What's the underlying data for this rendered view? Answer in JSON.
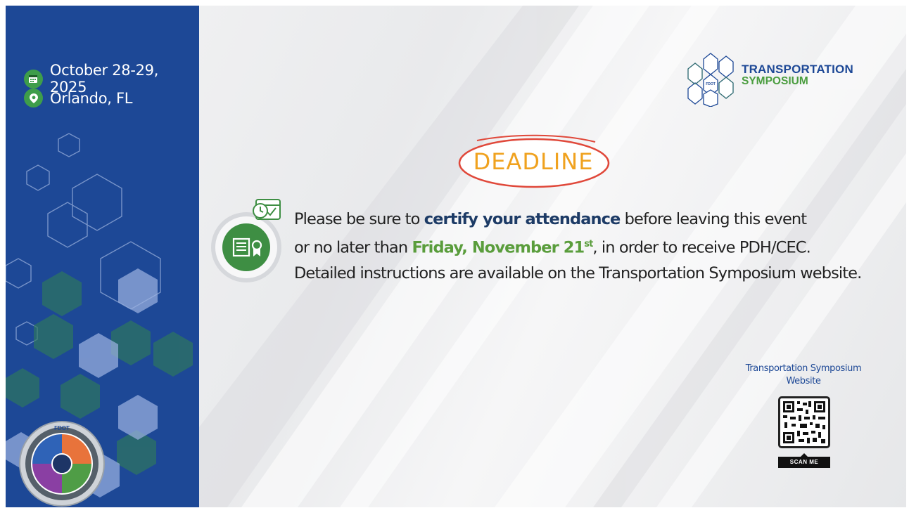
{
  "event": {
    "date": "October 28-29, 2025",
    "location": "Orlando, FL",
    "date_icon": "calendar-icon",
    "location_icon": "location-pin-icon"
  },
  "logo": {
    "line1": "TRANSPORTATION",
    "line2": "SYMPOSIUM",
    "inner_text": "FDOT"
  },
  "deadline": {
    "label": "DEADLINE"
  },
  "message": {
    "line1_pre": "Please be sure to ",
    "line1_emphasis": "certify your attendance",
    "line1_post": " before leaving this event",
    "line2_pre": "or no later than ",
    "line2_emphasis": "Friday, November 21",
    "line2_sup": "st",
    "line2_post": ", in order to receive PDH/CEC.",
    "line3": "Detailed instructions are available on the Transportation Symposium website."
  },
  "qr": {
    "label": "Transportation Symposium Website",
    "scan_label": "SCAN ME"
  },
  "badge": {
    "label": "FDOT"
  },
  "colors": {
    "sidebar_blue": "#1d4896",
    "accent_green": "#4a9d3f",
    "deadline_orange": "#f0a21f",
    "deadline_red": "#e0483a",
    "emphasis_navy": "#1d3b66"
  }
}
